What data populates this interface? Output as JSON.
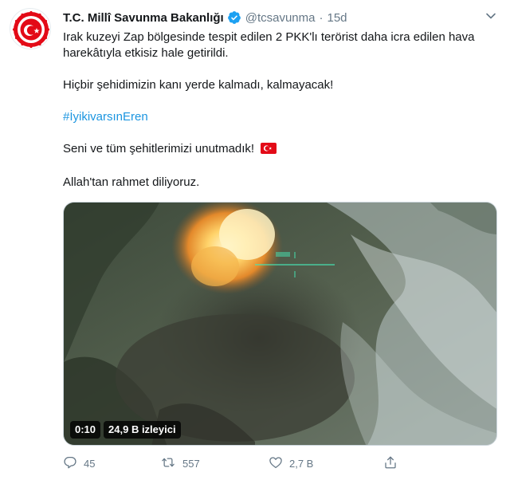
{
  "tweet": {
    "author_name": "T.C. Millî Savunma Bakanlığı",
    "handle": "@tcsavunma",
    "separator": "·",
    "time": "15d",
    "lines": {
      "p1": "Irak kuzeyi Zap bölgesinde tespit edilen 2 PKK'lı terörist daha icra edilen hava harekâtıyla etkisiz hale getirildi.",
      "p2": "Hiçbir şehidimizin kanı yerde kalmadı, kalmayacak!",
      "p3": "#İyikivarsınEren",
      "p4": "Seni ve tüm şehitlerimizi unutmadık!",
      "p5": "Allah'tan rahmet diliyoruz."
    },
    "video": {
      "duration": "0:10",
      "views": "24,9 B izleyici"
    },
    "actions": {
      "replies": "45",
      "retweets": "557",
      "likes": "2,7 B"
    }
  },
  "icons": {
    "verified": "verified-badge-icon",
    "caret": "chevron-down-icon",
    "reply": "reply-icon",
    "retweet": "retweet-icon",
    "like": "heart-icon",
    "share": "share-icon",
    "flag": "turkey-flag-icon"
  },
  "colors": {
    "accent": "#1b95e0",
    "muted": "#657786",
    "text": "#14171a",
    "logo_red": "#e30a17"
  }
}
